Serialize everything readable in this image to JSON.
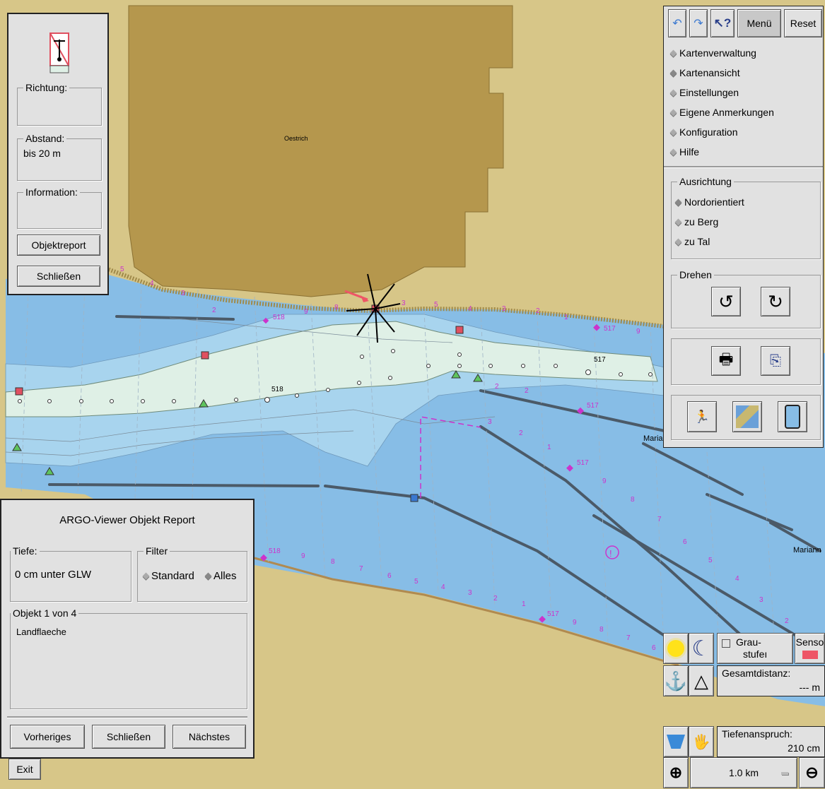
{
  "map": {
    "place_oestrich": "Oestrich",
    "place_mariann": "Marianı",
    "place_mariann2": "Mariann",
    "km_517": "517",
    "km_518": "518",
    "hm_labels": [
      "2",
      "3",
      "4",
      "5",
      "6",
      "7",
      "8",
      "9"
    ]
  },
  "object_panel": {
    "richtung_label": "Richtung:",
    "richtung_value": "",
    "abstand_label": "Abstand:",
    "abstand_value": "bis 20 m",
    "information_label": "Information:",
    "information_value": "",
    "objektreport_button": "Objektreport",
    "close_button": "Schließen"
  },
  "toolbar": {
    "menu_button": "Menü",
    "reset_button": "Reset"
  },
  "menu": {
    "items": [
      "Kartenverwaltung",
      "Kartenansicht",
      "Einstellungen",
      "Eigene Anmerkungen",
      "Konfiguration",
      "Hilfe"
    ]
  },
  "orientation": {
    "title": "Ausrichtung",
    "options": [
      "Nordorientiert",
      "zu Berg",
      "zu Tal"
    ],
    "selected": "Nordorientiert"
  },
  "rotate": {
    "title": "Drehen"
  },
  "report": {
    "title": "ARGO-Viewer Objekt Report",
    "tiefe_label": "Tiefe:",
    "tiefe_value": "0 cm unter GLW",
    "filter_label": "Filter",
    "filter_standard": "Standard",
    "filter_alles": "Alles",
    "objekt_label": "Objekt 1 von 4",
    "objekt_value": "Landflaeche",
    "prev_button": "Vorheriges",
    "close_button": "Schließen",
    "next_button": "Nächstes"
  },
  "exit_button": "Exit",
  "status": {
    "graustufen_line1": "Grau-",
    "graustufen_line2": "stufeı",
    "sensor_label": "Senso",
    "gesamtdistanz_label": "Gesamtdistanz:",
    "gesamtdistanz_value": "--- m",
    "tiefenanspruch_label": "Tiefenanspruch:",
    "tiefenanspruch_value": "210 cm",
    "scale_value": "1.0 km"
  },
  "colors": {
    "land": "#d7c688",
    "town": "#b5974d",
    "water": "#87bde6",
    "shallow": "#a8d4ee",
    "fairway_light": "#dff0e6",
    "panel": "#e1e1e1",
    "marker_magenta": "#cc33cc"
  }
}
